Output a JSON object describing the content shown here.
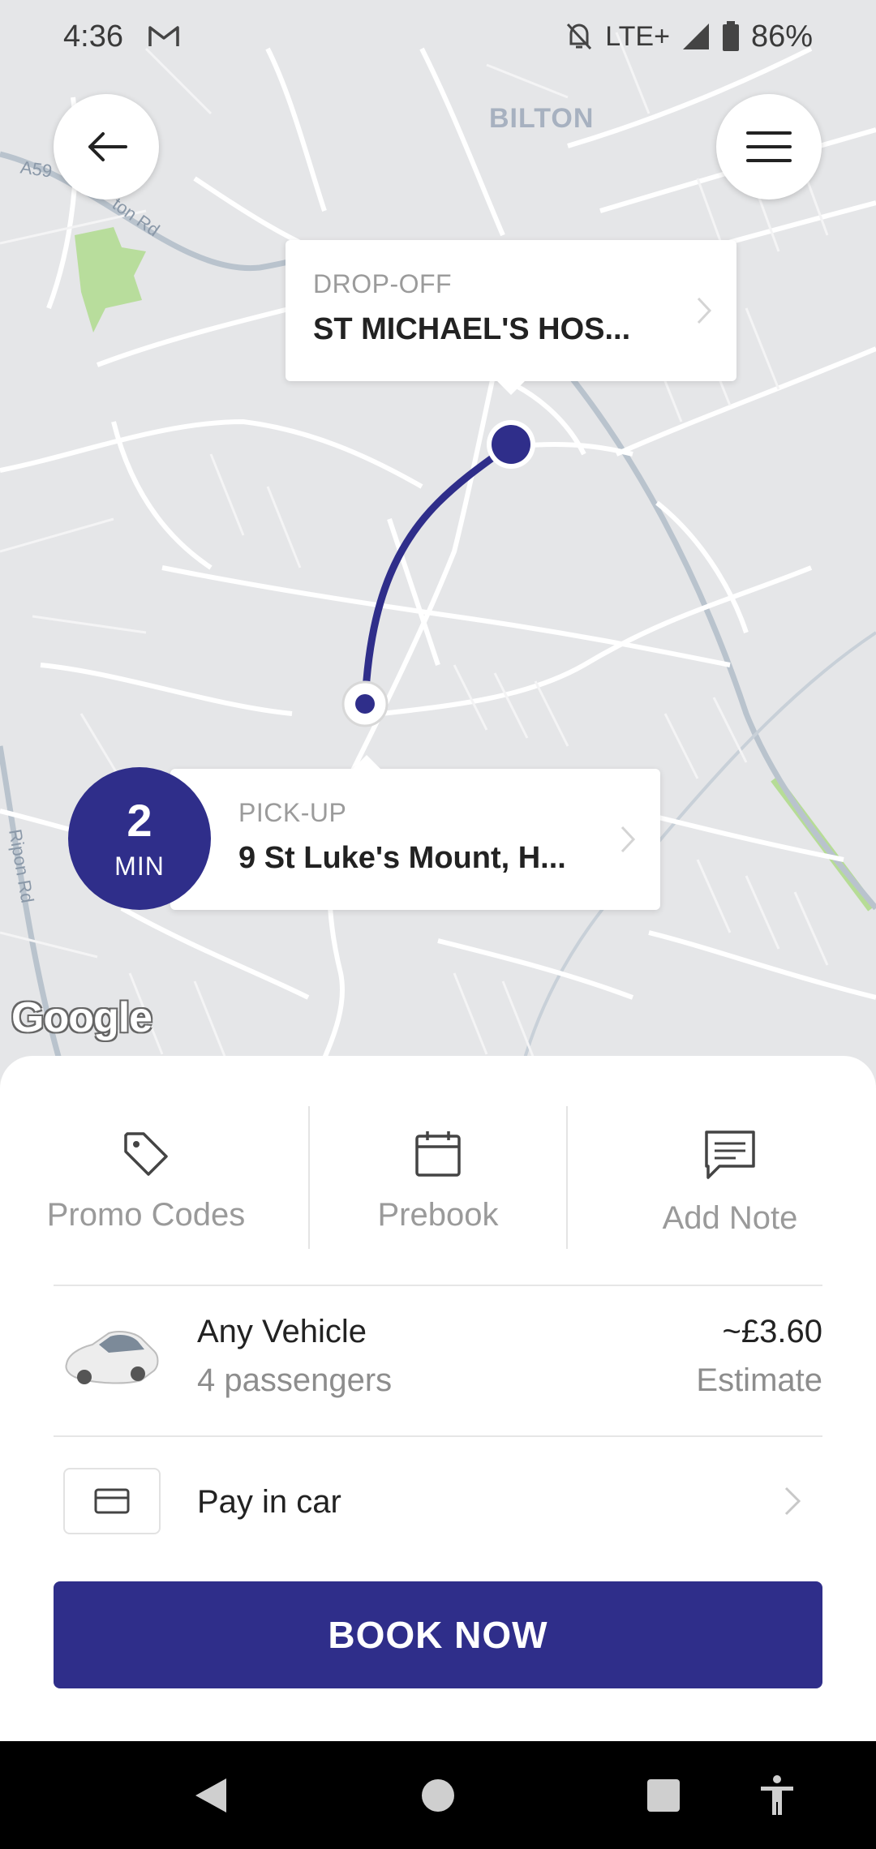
{
  "status_bar": {
    "time": "4:36",
    "network": "LTE+",
    "battery": "86%",
    "icons": [
      "gmail-icon",
      "mute-icon",
      "signal-icon",
      "battery-icon"
    ]
  },
  "map": {
    "area_label": "BILTON",
    "road_labels": [
      "A59",
      "ton Rd",
      "Ripon Rd"
    ],
    "attribution": "Google",
    "dropoff": {
      "heading": "DROP-OFF",
      "address": "ST MICHAEL'S HOS..."
    },
    "pickup": {
      "heading": "PICK-UP",
      "address": "9 St Luke's Mount, H..."
    },
    "eta": {
      "value": "2",
      "unit": "MIN"
    },
    "route_color": "#2f2e8a"
  },
  "actions": [
    {
      "label": "Promo Codes",
      "icon": "tag-icon"
    },
    {
      "label": "Prebook",
      "icon": "calendar-icon"
    },
    {
      "label": "Add Note",
      "icon": "note-icon"
    }
  ],
  "vehicle": {
    "name": "Any Vehicle",
    "passengers": "4 passengers",
    "price": "~£3.60",
    "price_note": "Estimate"
  },
  "payment": {
    "label": "Pay in car"
  },
  "book_button": "BOOK NOW",
  "colors": {
    "accent": "#2f2e8a",
    "map_bg": "#e5e6e8"
  }
}
